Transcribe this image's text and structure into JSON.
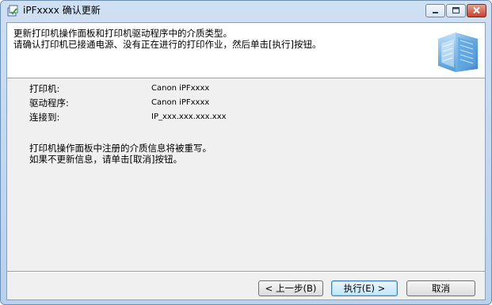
{
  "window": {
    "title": "iPFxxxx  确认更新",
    "icon": "install-wizard-icon"
  },
  "header": {
    "line1": "更新打印机操作面板和打印机驱动程序中的介质类型。",
    "line2": "请确认打印机已接通电源、没有正在进行的打印作业，然后单击[执行]按钮。",
    "graphic": "paper-stack-graphic"
  },
  "info": {
    "rows": [
      {
        "label": "打印机:",
        "value": "Canon iPFxxxx"
      },
      {
        "label": "驱动程序:",
        "value": "Canon iPFxxxx"
      },
      {
        "label": "连接到:",
        "value": "IP_xxx.xxx.xxx.xxx"
      }
    ]
  },
  "notes": {
    "line1": "打印机操作面板中注册的介质信息将被重写。",
    "line2": "如果不更新信息，请单击[取消]按钮。"
  },
  "buttons": {
    "back_label": "< 上一步(B)",
    "execute_label": "执行(E) >",
    "cancel_label": "取消"
  }
}
